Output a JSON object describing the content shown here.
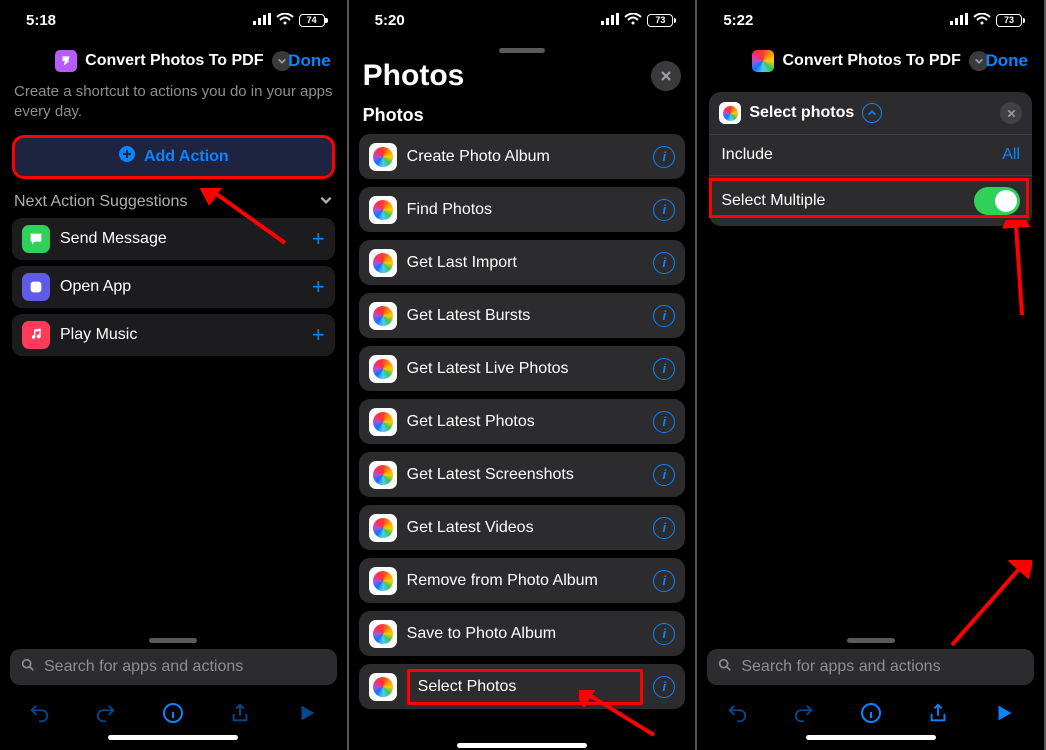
{
  "left": {
    "status": {
      "time": "5:18",
      "battery": "74"
    },
    "title": "Convert Photos To PDF",
    "done": "Done",
    "intro": "Create a shortcut to actions you do in your apps every day.",
    "add_action": "Add Action",
    "suggestions_heading": "Next Action Suggestions",
    "suggestions": [
      {
        "label": "Send Message",
        "color": "#30d158"
      },
      {
        "label": "Open App",
        "color": "#5e5ce6"
      },
      {
        "label": "Play Music",
        "color": "#ff3b5c"
      }
    ],
    "search_placeholder": "Search for apps and actions"
  },
  "middle": {
    "status": {
      "time": "5:20",
      "battery": "73"
    },
    "sheet_title": "Photos",
    "section_label": "Photos",
    "actions": [
      "Create Photo Album",
      "Find Photos",
      "Get Last Import",
      "Get Latest Bursts",
      "Get Latest Live Photos",
      "Get Latest Photos",
      "Get Latest Screenshots",
      "Get Latest Videos",
      "Remove from Photo Album",
      "Save to Photo Album",
      "Select Photos"
    ],
    "highlight_index": 10
  },
  "right": {
    "status": {
      "time": "5:22",
      "battery": "73"
    },
    "title": "Convert Photos To PDF",
    "done": "Done",
    "card": {
      "title": "Select photos",
      "include_label": "Include",
      "include_value": "All",
      "multiple_label": "Select Multiple",
      "multiple_on": true
    },
    "search_placeholder": "Search for apps and actions"
  }
}
